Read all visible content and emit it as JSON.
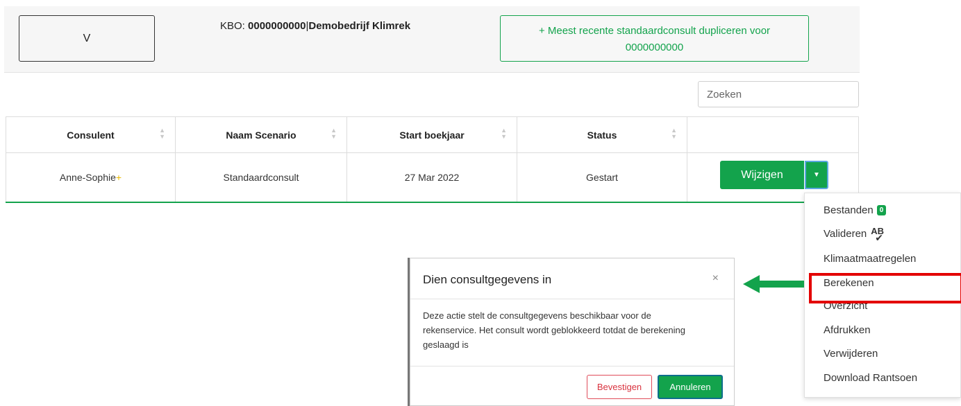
{
  "header": {
    "v_button": "V",
    "kbo_label": "KBO: ",
    "kbo_number": "0000000000",
    "kbo_separator": "|",
    "company_name": "Demobedrijf Klimrek",
    "duplicate_button": "+ Meest recente standaardconsult dupliceren voor 0000000000"
  },
  "search": {
    "placeholder": "Zoeken"
  },
  "table": {
    "columns": [
      "Consulent",
      "Naam Scenario",
      "Start boekjaar",
      "Status",
      ""
    ],
    "rows": [
      {
        "consulent": "Anne-Sophie",
        "consulent_marker": "+",
        "scenario": "Standaardconsult",
        "start": "27 Mar 2022",
        "status": "Gestart"
      }
    ]
  },
  "actions": {
    "wijzigen": "Wijzigen",
    "caret": "▼"
  },
  "dropdown": {
    "items": [
      "Bestanden",
      "Valideren",
      "Klimaatmaatregelen",
      "Berekenen",
      "Overzicht",
      "Afdrukken",
      "Verwijderen",
      "Download Rantsoen"
    ],
    "bestanden_badge": "0",
    "valideren_icon": "AB",
    "highlighted": "Berekenen",
    "highlight_color": "#e30000"
  },
  "modal": {
    "title": "Dien consultgegevens in",
    "close": "×",
    "body": "Deze actie stelt de consultgegevens beschikbaar voor de rekenservice. Het consult wordt geblokkeerd totdat de berekening geslaagd is",
    "confirm": "Bevestigen",
    "cancel": "Annuleren"
  },
  "colors": {
    "accent": "#13a34c",
    "danger": "#d9333f",
    "highlight": "#e30000"
  }
}
